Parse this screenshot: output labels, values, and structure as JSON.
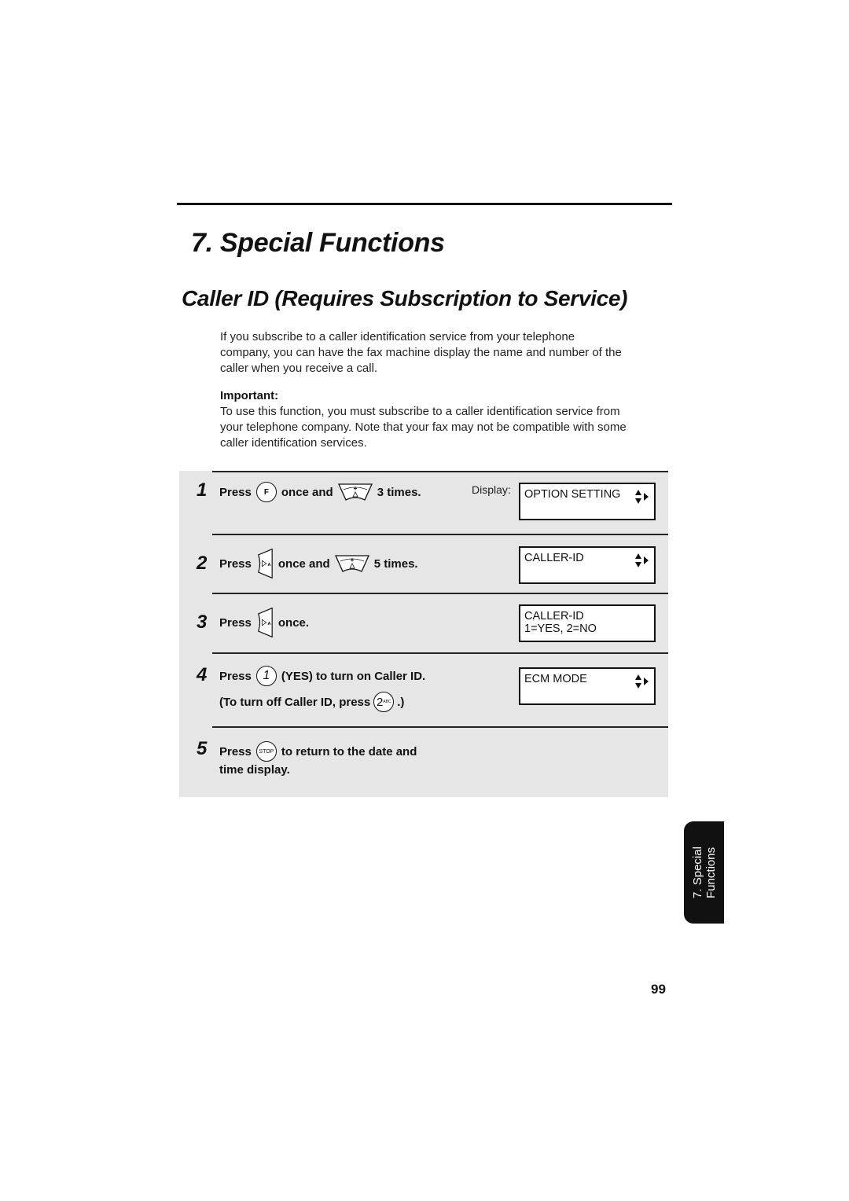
{
  "chapter": {
    "title": "7.  Special Functions"
  },
  "section": {
    "title": "Caller ID (Requires Subscription to Service)"
  },
  "intro": {
    "lines": [
      "If you subscribe to a caller identification service from your telephone",
      "company, you can have the fax machine display the name and number of the",
      "caller when you receive a call."
    ]
  },
  "important": {
    "label": "Important:",
    "lines": [
      "To use this function, you must subscribe to a caller identification service from",
      "your telephone company. Note that your fax may not be compatible with some",
      "caller identification services."
    ]
  },
  "steps": [
    {
      "number": "1",
      "press": "Press",
      "key1": "F",
      "mid": "once and",
      "key2_icon": "up-down-arrow-key",
      "end": "3 times."
    },
    {
      "number": "2",
      "press": "Press",
      "key1_icon": "right-arrow-key",
      "mid": "once and",
      "key2_icon": "up-down-arrow-key",
      "end": "5 times."
    },
    {
      "number": "3",
      "press": "Press",
      "key1_icon": "right-arrow-key",
      "end": "once."
    },
    {
      "number": "4",
      "press": "Press",
      "key1": "1",
      "end": "(YES) to turn on Caller ID.",
      "line2_start": "(To turn off Caller ID, press",
      "line2_key": "2",
      "line2_key_sub": "ABC",
      "line2_end": ".)"
    },
    {
      "number": "5",
      "press": "Press",
      "key1": "STOP",
      "end": "to return to the date and",
      "line2": "time display."
    }
  ],
  "display": {
    "label": "Display:",
    "screens": [
      {
        "line1": "OPTION SETTING",
        "line2": "",
        "arrows": true
      },
      {
        "line1": "CALLER-ID",
        "line2": "",
        "arrows": true
      },
      {
        "line1": "CALLER-ID",
        "line2": "1=YES, 2=NO",
        "arrows": false
      },
      {
        "line1": "ECM MODE",
        "line2": "",
        "arrows": true
      }
    ]
  },
  "side_tab": {
    "line1": "7. Special",
    "line2": "Functions"
  },
  "page_number": "99"
}
